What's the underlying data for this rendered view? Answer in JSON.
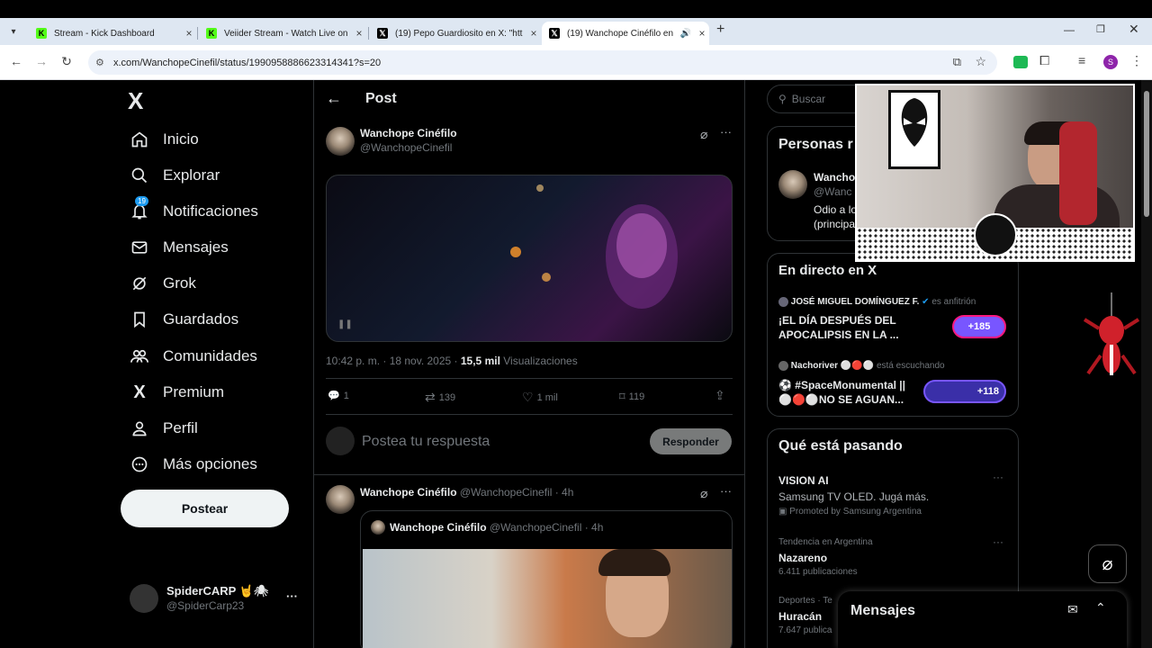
{
  "browser": {
    "tabs": [
      {
        "title": "Stream - Kick Dashboard",
        "favicon": "kick-icon"
      },
      {
        "title": "Veiider Stream - Watch Live on",
        "favicon": "kick-icon"
      },
      {
        "title": "(19) Pepo Guardiosito en X: \"htt",
        "favicon": "x-icon"
      },
      {
        "title": "(19) Wanchope Cinéfilo en",
        "favicon": "x-icon"
      }
    ],
    "new_tab": "+",
    "url": "x.com/WanchopeCinefil/status/1990958886623314341?s=20",
    "profile_initial": "S"
  },
  "sidebar": {
    "logo": "X",
    "items": [
      {
        "label": "Inicio",
        "icon": "home-icon"
      },
      {
        "label": "Explorar",
        "icon": "search-icon"
      },
      {
        "label": "Notificaciones",
        "icon": "bell-icon",
        "badge": "19"
      },
      {
        "label": "Mensajes",
        "icon": "mail-icon"
      },
      {
        "label": "Grok",
        "icon": "grok-icon"
      },
      {
        "label": "Guardados",
        "icon": "bookmark-icon"
      },
      {
        "label": "Comunidades",
        "icon": "communities-icon"
      },
      {
        "label": "Premium",
        "icon": "x-icon"
      },
      {
        "label": "Perfil",
        "icon": "person-icon"
      },
      {
        "label": "Más opciones",
        "icon": "more-circle-icon"
      }
    ],
    "post_button": "Postear",
    "account": {
      "name": "SpiderCARP",
      "emoji": "🤘🕷",
      "handle": "@SpiderCarp23",
      "more": "···"
    }
  },
  "post": {
    "header": "Post",
    "author_name": "Wanchope Cinéfilo",
    "author_handle": "@WanchopeCinefil",
    "timestamp": "10:42 p. m. · 18 nov. 2025 · ",
    "views_count": "15,5 mil",
    "views_label": " Visualizaciones",
    "stats": {
      "replies": "1",
      "reposts": "139",
      "likes": "1 mil",
      "bookmarks": "119"
    },
    "reply_placeholder": "Postea tu respuesta",
    "reply_button": "Responder"
  },
  "reply": {
    "author_name": "Wanchope Cinéfilo",
    "author_handle": "@WanchopeCinefil",
    "time": " · 4h",
    "quote_name": "Wanchope Cinéfilo",
    "quote_handle": "@WanchopeCinefil",
    "quote_time": " · 4h"
  },
  "right": {
    "search_placeholder": "Buscar",
    "people_title": "Personas r",
    "people_name": "Wancho",
    "people_handle": "@Wanc",
    "people_bio_1": "Odio a lo",
    "people_bio_2": "(principa",
    "live_title": "En directo en X",
    "live1_host": "JOSÉ MIGUEL DOMÍNGUEZ F.",
    "live1_role": "es anfitrión",
    "live1_title": "¡EL DÍA DESPUÉS DEL APOCALIPSIS EN LA ...",
    "live1_count": "+185",
    "live2_host": "Nachoriver",
    "live2_role": "está escuchando",
    "live2_title": "#SpaceMonumental || ⚪🔴⚪NO SE AGUAN...",
    "live2_title_a": "⚽ #SpaceMonumental ||",
    "live2_title_b": "⚪🔴⚪NO SE AGUAN...",
    "live2_count": "+118",
    "trends_title": "Qué está pasando",
    "trends": [
      {
        "context": "",
        "name": "VISION AI",
        "sub": "Samsung TV OLED. Jugá más.",
        "promo": "Promoted by Samsung Argentina"
      },
      {
        "context": "Tendencia en Argentina",
        "name": "Nazareno",
        "sub": "6.411 publicaciones"
      },
      {
        "context": "Deportes · Te",
        "name": "Huracán",
        "sub": "7.647 publica"
      }
    ],
    "messages_title": "Mensajes"
  },
  "colors": {
    "accent": "#1d9bf0",
    "live_purple": "#7856ff",
    "live_pink": "#f91880",
    "bg": "#000000"
  }
}
